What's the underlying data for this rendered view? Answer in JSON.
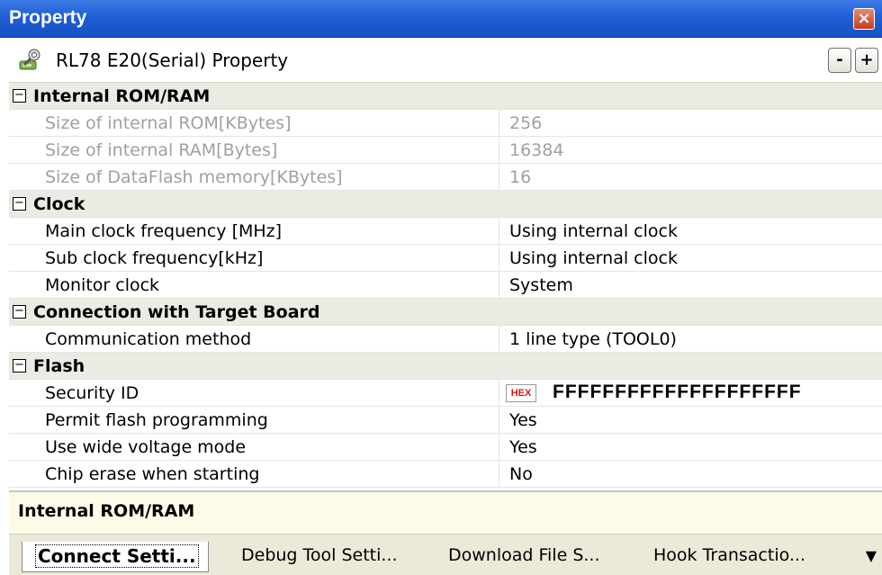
{
  "window": {
    "title": "Property",
    "close_glyph": "×"
  },
  "header": {
    "icon": "property-wrench-icon",
    "title": "RL78 E20(Serial) Property",
    "collapse_label": "-",
    "expand_label": "+"
  },
  "categories": [
    {
      "label": "Internal ROM/RAM",
      "toggle": "−",
      "rows": [
        {
          "name": "Size of internal ROM[KBytes]",
          "value": "256",
          "disabled": true
        },
        {
          "name": "Size of internal RAM[Bytes]",
          "value": "16384",
          "disabled": true
        },
        {
          "name": "Size of DataFlash memory[KBytes]",
          "value": "16",
          "disabled": true
        }
      ]
    },
    {
      "label": "Clock",
      "toggle": "−",
      "rows": [
        {
          "name": "Main clock frequency [MHz]",
          "value": "Using internal clock"
        },
        {
          "name": "Sub clock frequency[kHz]",
          "value": "Using internal clock"
        },
        {
          "name": "Monitor clock",
          "value": "System"
        }
      ]
    },
    {
      "label": "Connection with Target Board",
      "toggle": "−",
      "rows": [
        {
          "name": "Communication method",
          "value": "1 line type (TOOL0)"
        }
      ]
    },
    {
      "label": "Flash",
      "toggle": "−",
      "rows": [
        {
          "name": "Security ID",
          "badge": "HEX",
          "value": "FFFFFFFFFFFFFFFFFFFF"
        },
        {
          "name": "Permit flash programming",
          "value": "Yes"
        },
        {
          "name": "Use wide voltage mode",
          "value": "Yes"
        },
        {
          "name": "Chip erase when starting",
          "value": "No"
        }
      ]
    }
  ],
  "description": {
    "text": "Internal ROM/RAM"
  },
  "tabs": [
    {
      "label": "Connect Setti...",
      "active": true
    },
    {
      "label": "Debug Tool Setti...",
      "active": false
    },
    {
      "label": "Download File S...",
      "active": false
    },
    {
      "label": "Hook Transactio...",
      "active": false
    }
  ],
  "tab_menu_glyph": "▼"
}
